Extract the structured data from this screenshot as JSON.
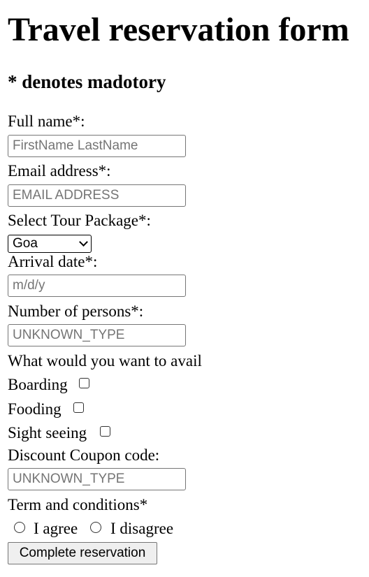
{
  "page": {
    "title": "Travel reservation form",
    "mandatory_note": "* denotes madotory"
  },
  "form": {
    "full_name": {
      "label": "Full name*:",
      "placeholder": "FirstName LastName",
      "value": ""
    },
    "email": {
      "label": "Email address*:",
      "placeholder": "EMAIL ADDRESS",
      "value": ""
    },
    "tour_package": {
      "label": "Select Tour Package*:",
      "selected": "Goa"
    },
    "arrival_date": {
      "label": "Arrival date*:",
      "placeholder": "m/d/y",
      "value": ""
    },
    "persons": {
      "label": "Number of persons*:",
      "placeholder": "UNKNOWN_TYPE",
      "value": ""
    },
    "avail": {
      "label": "What would you want to avail",
      "options": [
        {
          "label": "Boarding",
          "checked": false
        },
        {
          "label": "Fooding",
          "checked": false
        },
        {
          "label": "Sight seeing",
          "checked": false
        }
      ]
    },
    "coupon": {
      "label": "Discount Coupon code:",
      "placeholder": "UNKNOWN_TYPE",
      "value": ""
    },
    "terms": {
      "label": "Term and conditions*",
      "options": [
        {
          "label": "I agree",
          "selected": false
        },
        {
          "label": "I disagree",
          "selected": false
        }
      ]
    },
    "submit_label": "Complete reservation"
  }
}
